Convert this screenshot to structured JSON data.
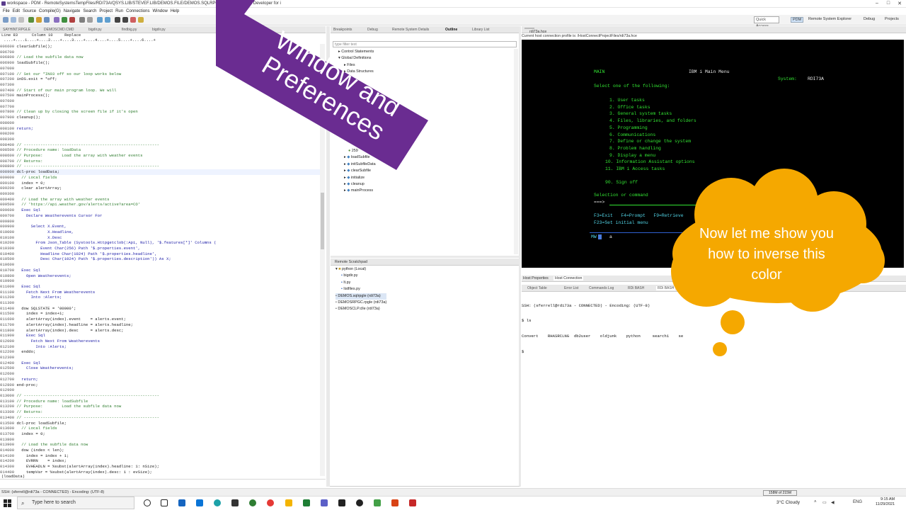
{
  "title_bar": {
    "title": "workspace - PDM - RemoteSystemsTempFiles/RDI73A/QSYS.LIB/STEVEF.LIB/DEMOS.FILE/DEMOS.SQLRPGLE - IBM Rational Developer for i"
  },
  "menu": [
    "File",
    "Edit",
    "Source",
    "Compile(G)",
    "Navigate",
    "Search",
    "Project",
    "Run",
    "Connections",
    "Window",
    "Help"
  ],
  "toolbar": {
    "quick_access": "Quick Access",
    "perspectives": [
      "PDM",
      "Remote System Explorer",
      "Debug",
      "Projects"
    ]
  },
  "editor": {
    "tabs": [
      "SAYHINT.RPGLE",
      "DEMOSCMD.CMD",
      "bigdir.py",
      "findbig.py",
      "bigdir.py"
    ],
    "ruler_line": "Line 83      Column 10     Replace",
    "ruler_scale": " ....+....1....+....2....+....3....+....4....+....5....+....6....+",
    "status_expr": "(loadData)",
    "lines": [
      {
        "n": "006600",
        "t": "clearSubfile();",
        "k": "code"
      },
      {
        "n": "006700",
        "t": "",
        "k": "code"
      },
      {
        "n": "006800",
        "t": "// Load the subfile data now",
        "k": "cm"
      },
      {
        "n": "006900",
        "t": "loadSubfile();",
        "k": "code"
      },
      {
        "n": "007000",
        "t": "",
        "k": "code"
      },
      {
        "n": "007100",
        "t": "// Set our *IN03 off so our loop works below",
        "k": "cm"
      },
      {
        "n": "007200",
        "t": "inDS.exit = *off;",
        "k": "code"
      },
      {
        "n": "007300",
        "t": "",
        "k": "code"
      },
      {
        "n": "007400",
        "t": "// Start of our main program loop. We will",
        "k": "cm"
      },
      {
        "n": "007500",
        "t": "mainProcess();",
        "k": "code"
      },
      {
        "n": "007600",
        "t": "",
        "k": "code"
      },
      {
        "n": "007700",
        "t": "",
        "k": "code"
      },
      {
        "n": "007800",
        "t": "// Clean up by closing the screen file if it's open",
        "k": "cm"
      },
      {
        "n": "007900",
        "t": "cleanup();",
        "k": "code"
      },
      {
        "n": "008000",
        "t": "",
        "k": "code"
      },
      {
        "n": "008100",
        "t": "return;",
        "k": "kw"
      },
      {
        "n": "008200",
        "t": "",
        "k": "code"
      },
      {
        "n": "008300",
        "t": "",
        "k": "code"
      },
      {
        "n": "008400",
        "t": "// ---------------------------------------------------------",
        "k": "cm"
      },
      {
        "n": "008500",
        "t": "// Procedure name: loadData",
        "k": "cm"
      },
      {
        "n": "008600",
        "t": "// Purpose:        Load the array with weather events",
        "k": "cm"
      },
      {
        "n": "008700",
        "t": "// Returns:",
        "k": "cm"
      },
      {
        "n": "008800",
        "t": "// ---------------------------------------------------------",
        "k": "cm"
      },
      {
        "n": "008900",
        "t": "dcl-proc loadData;",
        "k": "hl"
      },
      {
        "n": "009000",
        "t": "  // Local fields",
        "k": "cm"
      },
      {
        "n": "009100",
        "t": "  index = 0;",
        "k": "code"
      },
      {
        "n": "009200",
        "t": "  clear alertArray;",
        "k": "code"
      },
      {
        "n": "009300",
        "t": "",
        "k": "code"
      },
      {
        "n": "009400",
        "t": "  // Load the array with weather events",
        "k": "cm"
      },
      {
        "n": "009500",
        "t": "  // 'https://api.weather.gov/alerts/active?area=CO'",
        "k": "cm"
      },
      {
        "n": "009600",
        "t": "  Exec Sql",
        "k": "kw"
      },
      {
        "n": "009700",
        "t": "    Declare Weatherevents Cursor For",
        "k": "kw"
      },
      {
        "n": "009800",
        "t": "",
        "k": "code"
      },
      {
        "n": "009900",
        "t": "      Select X.Event,",
        "k": "kw"
      },
      {
        "n": "010000",
        "t": "             X.Headline,",
        "k": "kw"
      },
      {
        "n": "010100",
        "t": "             X.Desc",
        "k": "kw"
      },
      {
        "n": "010200",
        "t": "        From Json_Table (Systools.Httpgetclob(:Api, Null), '$.features[*]' Columns (",
        "k": "kw"
      },
      {
        "n": "010300",
        "t": "          Event Char(256) Path '$.properties.event',",
        "k": "kw"
      },
      {
        "n": "010400",
        "t": "          Headline Char(1024) Path '$.properties.headline',",
        "k": "kw"
      },
      {
        "n": "010500",
        "t": "          Desc Char(1024) Path '$.properties.description')) As X;",
        "k": "kw"
      },
      {
        "n": "010600",
        "t": "",
        "k": "code"
      },
      {
        "n": "010700",
        "t": "  Exec Sql",
        "k": "kw"
      },
      {
        "n": "010800",
        "t": "    Open Weatherevents;",
        "k": "kw"
      },
      {
        "n": "010900",
        "t": "",
        "k": "code"
      },
      {
        "n": "011000",
        "t": "  Exec Sql",
        "k": "kw"
      },
      {
        "n": "011100",
        "t": "    Fetch Next From Weatherevents",
        "k": "kw"
      },
      {
        "n": "011200",
        "t": "      Into :Alerts;",
        "k": "kw"
      },
      {
        "n": "011300",
        "t": "",
        "k": "code"
      },
      {
        "n": "011400",
        "t": "  dow SQLSTATE = '00000';",
        "k": "code"
      },
      {
        "n": "011500",
        "t": "    index = index+1;",
        "k": "code"
      },
      {
        "n": "011600",
        "t": "    alertArray(index).event    = alerts.event;",
        "k": "code"
      },
      {
        "n": "011700",
        "t": "    alertArray(index).headline = alerts.headline;",
        "k": "code"
      },
      {
        "n": "011800",
        "t": "    alertArray(index).desc     = alerts.desc;",
        "k": "code"
      },
      {
        "n": "011900",
        "t": "    Exec Sql",
        "k": "kw"
      },
      {
        "n": "012000",
        "t": "      Fetch Next From Weatherevents",
        "k": "kw"
      },
      {
        "n": "012100",
        "t": "        Into :Alerts;",
        "k": "kw"
      },
      {
        "n": "012200",
        "t": "  enddo;",
        "k": "code"
      },
      {
        "n": "012300",
        "t": "",
        "k": "code"
      },
      {
        "n": "012400",
        "t": "  Exec Sql",
        "k": "kw"
      },
      {
        "n": "012500",
        "t": "    Close Weatherevents;",
        "k": "kw"
      },
      {
        "n": "012600",
        "t": "",
        "k": "code"
      },
      {
        "n": "012700",
        "t": "  return;",
        "k": "kw"
      },
      {
        "n": "012800",
        "t": "end-proc;",
        "k": "code"
      },
      {
        "n": "012900",
        "t": "",
        "k": "code"
      },
      {
        "n": "013000",
        "t": "// ---------------------------------------------------------",
        "k": "cm"
      },
      {
        "n": "013100",
        "t": "// Procedure name: loadSubfile",
        "k": "cm"
      },
      {
        "n": "013200",
        "t": "// Purpose:        Load the subfile data now",
        "k": "cm"
      },
      {
        "n": "013300",
        "t": "// Returns:",
        "k": "cm"
      },
      {
        "n": "013400",
        "t": "// ---------------------------------------------------------",
        "k": "cm"
      },
      {
        "n": "013500",
        "t": "dcl-proc loadSubfile;",
        "k": "code"
      },
      {
        "n": "013600",
        "t": "  // Local fields",
        "k": "cm"
      },
      {
        "n": "013700",
        "t": "  index = 0;",
        "k": "code"
      },
      {
        "n": "013800",
        "t": "",
        "k": "code"
      },
      {
        "n": "013900",
        "t": "  // Load the subfile data now",
        "k": "cm"
      },
      {
        "n": "014000",
        "t": "  dow (index < len);",
        "k": "code"
      },
      {
        "n": "014100",
        "t": "    index = index + 1;",
        "k": "code"
      },
      {
        "n": "014200",
        "t": "    EVRRN    = index;",
        "k": "code"
      },
      {
        "n": "014300",
        "t": "    EVHEADLN = %subst(alertArray(index).headline: 1: nSize);",
        "k": "code"
      },
      {
        "n": "014400",
        "t": "    tempVar = %subst(alertArray(index).desc: 1 : evSize);",
        "k": "code"
      }
    ]
  },
  "outline": {
    "tabs": [
      "Breakpoints",
      "Debug",
      "Remote System Details",
      "Outline",
      "Library List"
    ],
    "filter_placeholder": "type filter text",
    "items": [
      "Control Statements",
      "Global Definitions",
      "Files",
      "Data Structures",
      "259",
      "loadSubfile",
      "initSubfileData",
      "clearSubfile",
      "initialize",
      "cleanup",
      "mainProcess"
    ]
  },
  "scratchpad": {
    "title": "Remote Scratchpad",
    "items": [
      "python (Local)",
      "bigdir.py",
      "lt.py",
      "listfiles.py",
      "DEMOS.sqlrpgle (rdi73a)",
      "DEMOSRPGC.rpgle (rdi73a)",
      "DEMOSCLP.clle (rdi73a)"
    ]
  },
  "terminal": {
    "tab": "rdi73a.hce",
    "header": "Current host connection profile is: /HostConnectProjectFiles/rdi73a.hce",
    "screen_id": "MAIN",
    "screen_title": "IBM i Main Menu",
    "system_label": "System:",
    "system_name": "RDI73A",
    "prompt": "Select one of the following:",
    "options": [
      "1. User tasks",
      "2. Office tasks",
      "3. General system tasks",
      "4. Files, libraries, and folders",
      "5. Programming",
      "6. Communications",
      "7. Define or change the system",
      "8. Problem handling",
      "9. Display a menu",
      "10. Information Assistant options",
      "11. IBM i Access tasks",
      "",
      "90. Sign off"
    ],
    "cmd_label": "Selection or command",
    "cmd_prompt": "===>",
    "fkeys_1": "F3=Exit   F4=Prompt   F9=Retrieve",
    "fkeys_2": "F23=Set initial menu",
    "status_left": "MW",
    "status_right": "a"
  },
  "properties": {
    "tabs": [
      "Host Properties",
      "Host Connection"
    ]
  },
  "console": {
    "tabs": [
      "Object Table",
      "Error List",
      "Commands Log",
      "RDi BASH",
      "RDi BASH"
    ],
    "lines": [
      "SSH: (sferrell@rdi73a - CONNECTED) - Encoding: (UTF-8)",
      "$ ls",
      "Convert    RHASRCLNG  db2user    oldjunk    python     search1    se",
      "$"
    ]
  },
  "statusbar": {
    "left": "SSH: (sferrell@rdi73a - CONNECTED) - Encoding: (UTF-8)",
    "memory": "158M of 215M"
  },
  "taskbar": {
    "search_placeholder": "Type here to search",
    "weather": "3°C  Cloudy",
    "lang": "ENG",
    "time": "9:15 AM",
    "date": "11/29/2021"
  },
  "annotations": {
    "banner_text": "Window and Preferences",
    "bubble_text": "Now let me show you how to inverse this color",
    "banner_color": "#6a2c91",
    "bubble_color": "#f5a800"
  },
  "colors": {
    "terminal_green": "#33e433",
    "terminal_white": "#e8e8e8",
    "terminal_cyan": "#52d4e6"
  }
}
